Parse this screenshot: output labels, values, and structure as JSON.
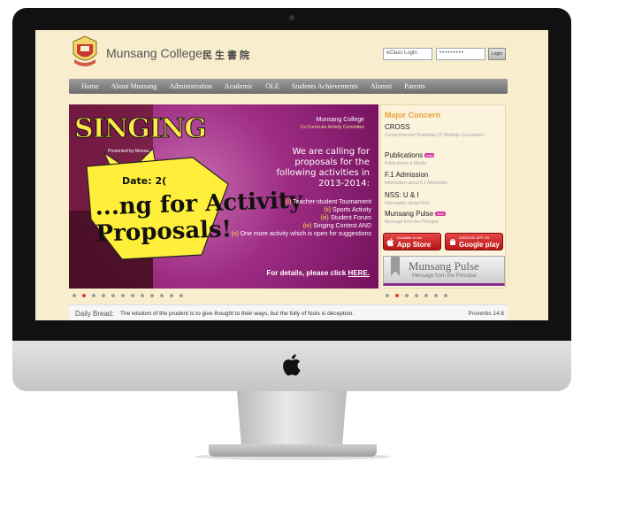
{
  "header": {
    "college_name": "Munsang College",
    "chinese_name": "民生書院",
    "login_placeholder": "eClass Login",
    "password_mask": "•••••••••",
    "login_button": "Login"
  },
  "nav": {
    "items": [
      "Home",
      "About Munsang",
      "Administration",
      "Academic",
      "OLE",
      "Students Achievements",
      "Alumni",
      "Parents"
    ]
  },
  "banner": {
    "singing": "SINGING",
    "presented": "Presented by Munsa...",
    "college": "Munsang College",
    "committee": "Co-Curricular Activity Committee",
    "calling": "We are calling for proposals for the following activities in 2013-2014:",
    "date": "Date: 2(",
    "big_text": "...ng for Activity Proposals!",
    "list": [
      {
        "num": "(i)",
        "text": "Teacher-student Tournament"
      },
      {
        "num": "(ii)",
        "text": "Sports Activity"
      },
      {
        "num": "(iii)",
        "text": "Student Forum"
      },
      {
        "num": "(iv)",
        "text": "Singing Contest AND"
      },
      {
        "num": "(v)",
        "text": "One more activity which is open for suggestions"
      }
    ],
    "details_prefix": "For details, please click",
    "details_link": "HERE.",
    "dots_count": 12,
    "active_dot": 1
  },
  "side": {
    "title": "Major Concern",
    "items": [
      {
        "label": "CROSS",
        "sub": "Comprehensive Roadmap Of Strategic Succession",
        "new": false
      },
      {
        "label": "Publications",
        "sub": "Publications & Media",
        "new": true
      },
      {
        "label": "F.1 Admission",
        "sub": "Information about F.1 Admission",
        "new": false
      },
      {
        "label": "NSS: U & I",
        "sub": "Information about NSS",
        "new": false
      },
      {
        "label": "Munsang Pulse",
        "sub": "Message from the Principal",
        "new": true
      }
    ],
    "new_badge": "new",
    "app_store_small": "Available on the",
    "app_store_big": "App Store",
    "google_play_small": "ANDROID APP ON",
    "google_play_big": "Google play",
    "pulse_title": "Munsang Pulse",
    "pulse_sub": "Message from the Principal",
    "dots_count": 7,
    "active_dot": 1
  },
  "daily_bread": {
    "label": "Daily Bread:",
    "text": "The wisdom of the prudent is to give thought to their ways, but the folly of fools is deception.",
    "reference": "Proverbs 14:8"
  }
}
